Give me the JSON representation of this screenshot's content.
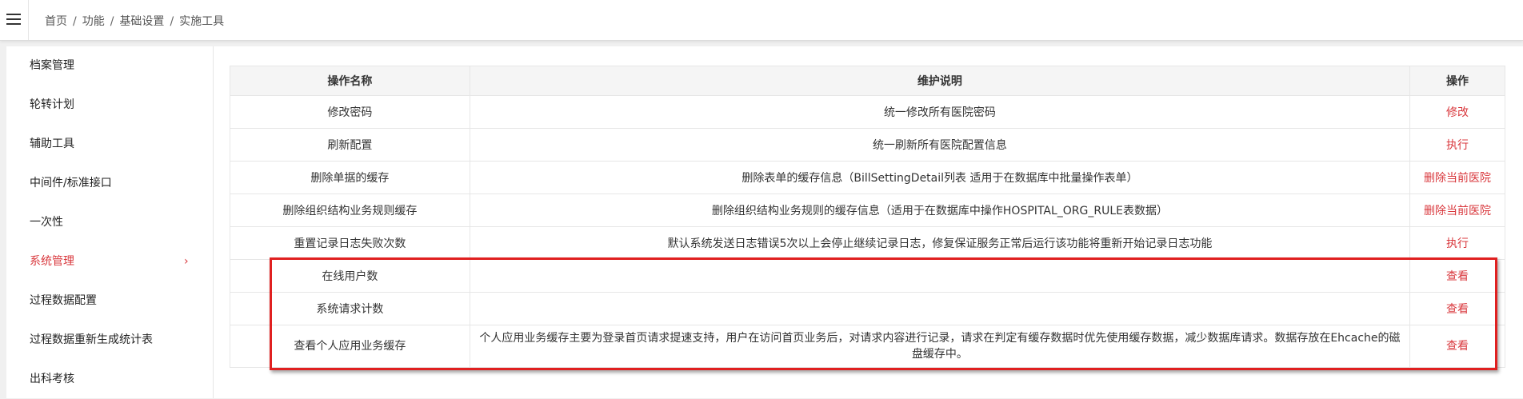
{
  "breadcrumb": [
    "首页",
    "功能",
    "基础设置",
    "实施工具"
  ],
  "sidebar": {
    "items": [
      {
        "label": "档案管理"
      },
      {
        "label": "轮转计划"
      },
      {
        "label": "辅助工具"
      },
      {
        "label": "中间件/标准接口"
      },
      {
        "label": "一次性"
      },
      {
        "label": "系统管理",
        "active": true,
        "chevron": "›"
      },
      {
        "label": "过程数据配置"
      },
      {
        "label": "过程数据重新生成统计表"
      },
      {
        "label": "出科考核"
      }
    ]
  },
  "table": {
    "columns": [
      "操作名称",
      "维护说明",
      "操作"
    ],
    "rows": [
      {
        "name": "修改密码",
        "desc": "统一修改所有医院密码",
        "action": "修改"
      },
      {
        "name": "刷新配置",
        "desc": "统一刷新所有医院配置信息",
        "action": "执行"
      },
      {
        "name": "删除单据的缓存",
        "desc": "删除表单的缓存信息（BillSettingDetail列表 适用于在数据库中批量操作表单）",
        "action": "删除当前医院"
      },
      {
        "name": "删除组织结构业务规则缓存",
        "desc": "删除组织结构业务规则的缓存信息（适用于在数据库中操作HOSPITAL_ORG_RULE表数据）",
        "action": "删除当前医院"
      },
      {
        "name": "重置记录日志失败次数",
        "desc": "默认系统发送日志错误5次以上会停止继续记录日志，修复保证服务正常后运行该功能将重新开始记录日志功能",
        "action": "执行"
      },
      {
        "name": "在线用户数",
        "desc": "",
        "action": "查看"
      },
      {
        "name": "系统请求计数",
        "desc": "",
        "action": "查看"
      },
      {
        "name": "查看个人应用业务缓存",
        "desc": "个人应用业务缓存主要为登录首页请求提速支持，用户在访问首页业务后，对请求内容进行记录，请求在判定有缓存数据时优先使用缓存数据，减少数据库请求。数据存放在Ehcache的磁盘缓存中。",
        "action": "查看"
      }
    ]
  },
  "icons": {
    "menu": "hamburger-icon",
    "chevron": "chevron-right-icon"
  },
  "colors": {
    "accent": "#d9383d",
    "highlight": "#e02020"
  }
}
